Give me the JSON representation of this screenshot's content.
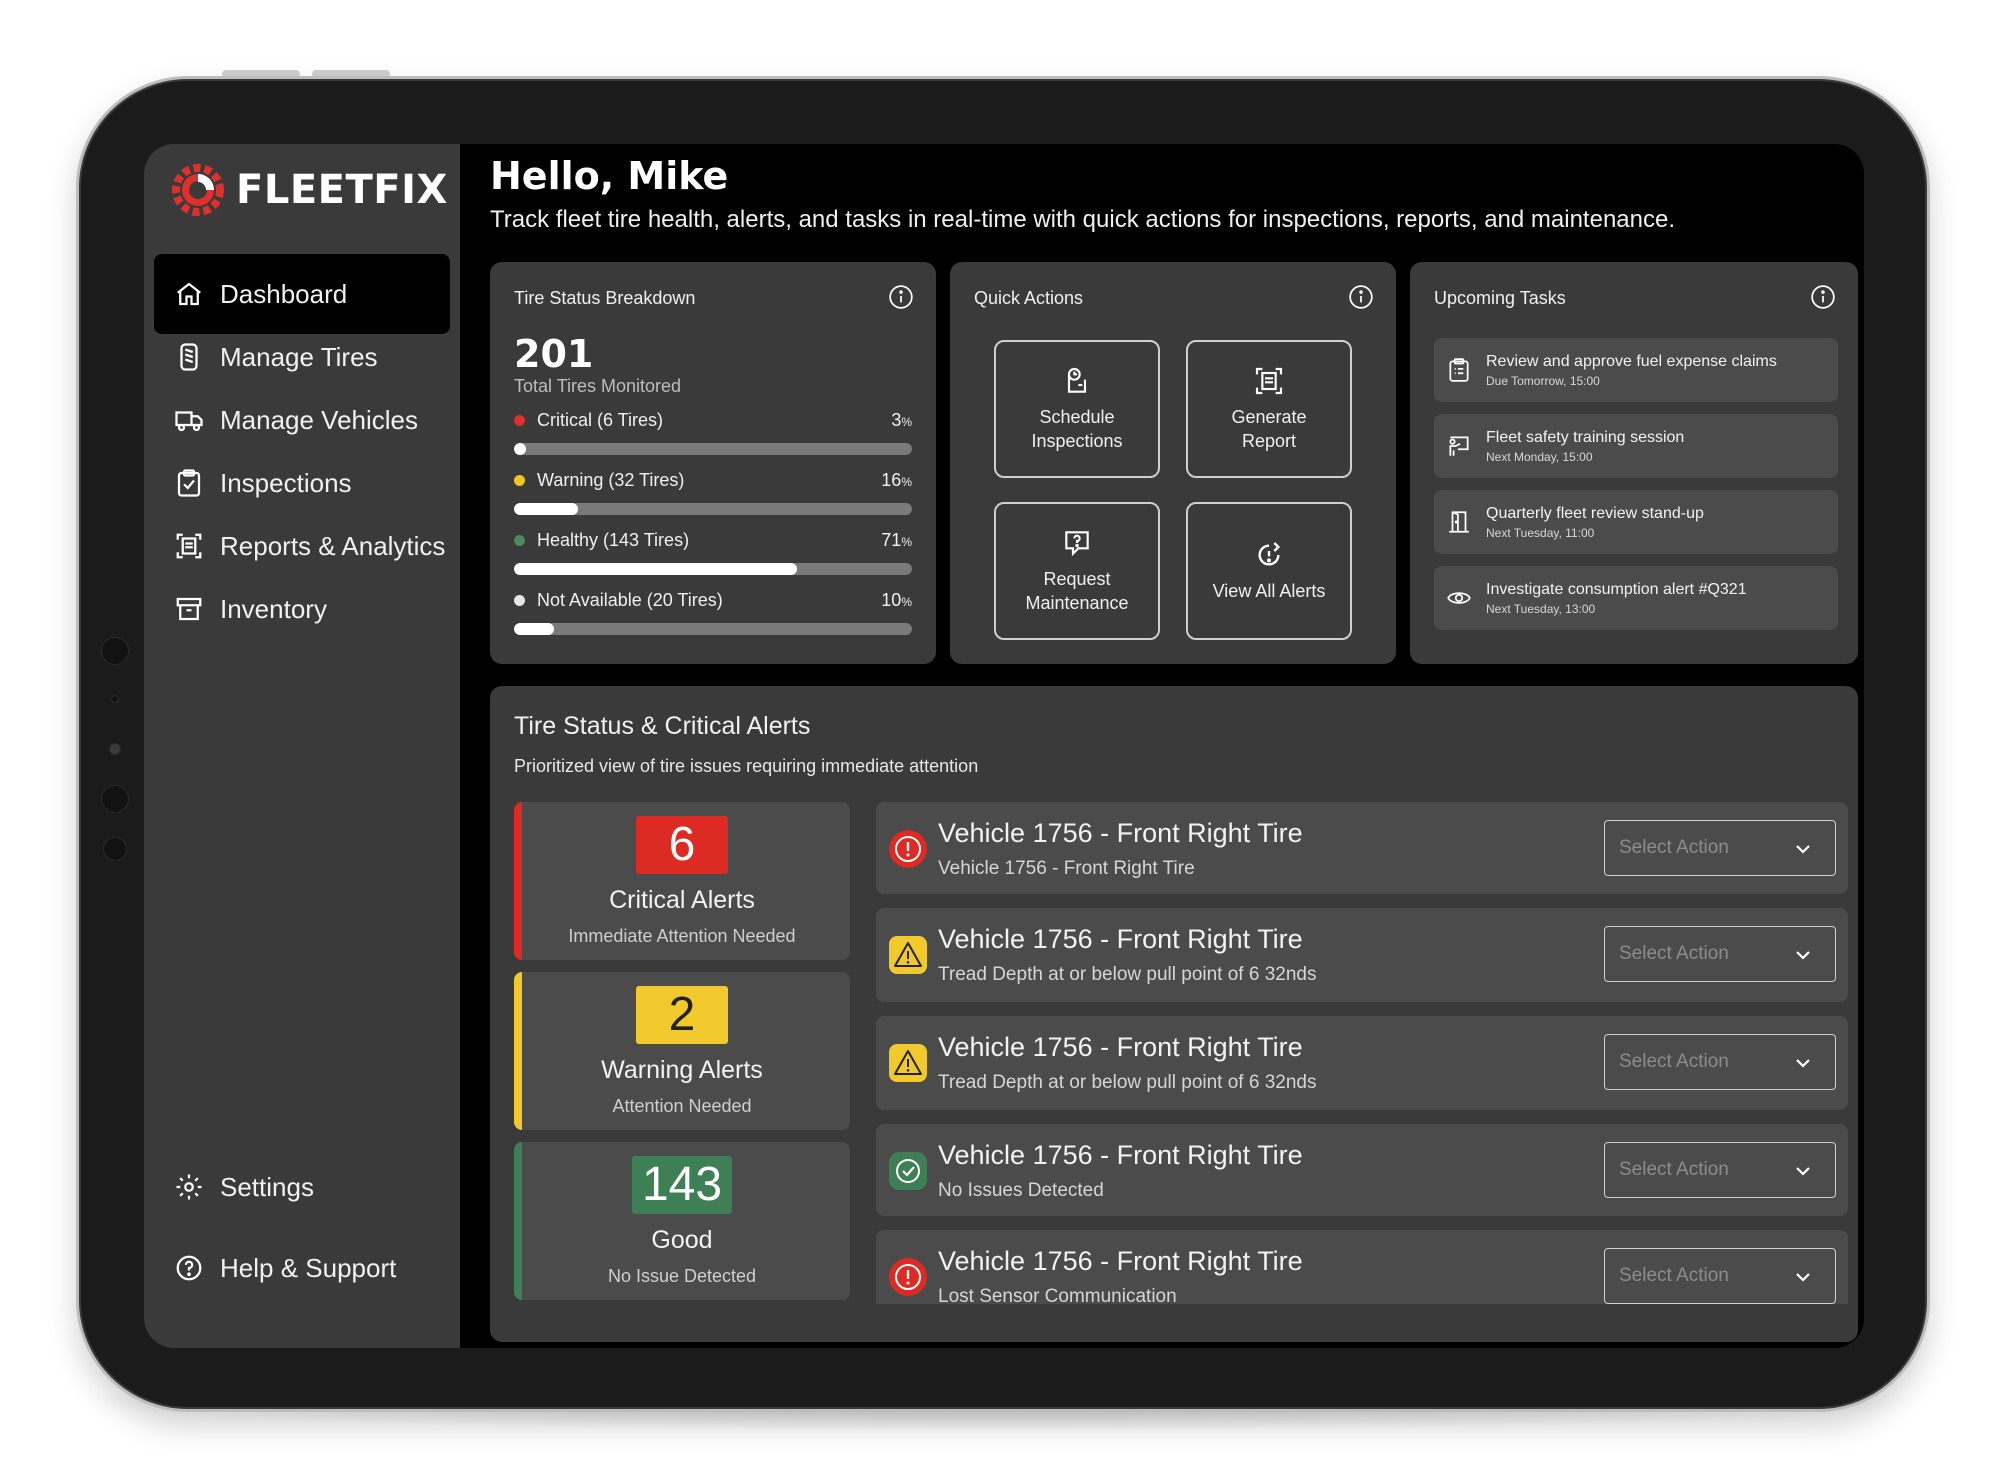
{
  "brand": {
    "name": "FLEETFIX"
  },
  "sidebar": {
    "items": [
      {
        "label": "Dashboard",
        "icon": "home-icon",
        "active": true
      },
      {
        "label": "Manage Tires",
        "icon": "tire-icon",
        "active": false
      },
      {
        "label": "Manage Vehicles",
        "icon": "truck-icon",
        "active": false
      },
      {
        "label": "Inspections",
        "icon": "clipboard-check-icon",
        "active": false
      },
      {
        "label": "Reports & Analytics",
        "icon": "report-icon",
        "active": false
      },
      {
        "label": "Inventory",
        "icon": "archive-icon",
        "active": false
      }
    ],
    "footer": [
      {
        "label": "Settings",
        "icon": "gear-icon"
      },
      {
        "label": "Help & Support",
        "icon": "help-icon"
      }
    ]
  },
  "header": {
    "greeting": "Hello, Mike",
    "subtitle": "Track fleet tire health, alerts, and tasks in real-time with quick actions for inspections, reports, and maintenance."
  },
  "tire_status": {
    "title": "Tire Status Breakdown",
    "total": "201",
    "total_label": "Total Tires Monitored",
    "rows": [
      {
        "label": "Critical (6 Tires)",
        "pct": "3",
        "fill": 0.03,
        "color": "#e0302b"
      },
      {
        "label": "Warning (32 Tires)",
        "pct": "16",
        "fill": 0.16,
        "color": "#f2c523"
      },
      {
        "label": "Healthy (143 Tires)",
        "pct": "71",
        "fill": 0.71,
        "color": "#4a8a5c"
      },
      {
        "label": "Not Available (20 Tires)",
        "pct": "10",
        "fill": 0.1,
        "color": "#e6e6e6"
      }
    ],
    "pct_unit": "%"
  },
  "quick_actions": {
    "title": "Quick Actions",
    "buttons": [
      {
        "label": "Schedule Inspections",
        "icon": "schedule-icon"
      },
      {
        "label": "Generate Report",
        "icon": "report-scan-icon"
      },
      {
        "label": "Request Maintenance",
        "icon": "message-question-icon"
      },
      {
        "label": "View All Alerts",
        "icon": "alert-refresh-icon"
      }
    ]
  },
  "tasks": {
    "title": "Upcoming Tasks",
    "items": [
      {
        "title": "Review and approve fuel expense claims",
        "due": "Due Tomorrow, 15:00",
        "icon": "checklist-icon"
      },
      {
        "title": "Fleet safety training session",
        "due": "Next Monday, 15:00",
        "icon": "presentation-icon"
      },
      {
        "title": "Quarterly fleet review stand-up",
        "due": "Next Tuesday, 11:00",
        "icon": "door-icon"
      },
      {
        "title": "Investigate consumption alert #Q321",
        "due": "Next Tuesday, 13:00",
        "icon": "eye-icon"
      }
    ]
  },
  "alerts_panel": {
    "title": "Tire Status & Critical Alerts",
    "subtitle": "Prioritized view of tire issues requiring immediate attention",
    "summary": [
      {
        "count": "6",
        "label": "Critical Alerts",
        "sub": "Immediate Attention Needed",
        "color": "#dd2a22"
      },
      {
        "count": "2",
        "label": "Warning Alerts",
        "sub": "Attention Needed",
        "color": "#f2c92c"
      },
      {
        "count": "143",
        "label": "Good",
        "sub": "No Issue Detected",
        "color": "#3f7f55"
      }
    ],
    "alerts": [
      {
        "title": "Vehicle 1756 - Front Right Tire",
        "sub": "Vehicle 1756 - Front Right Tire",
        "severity": "critical",
        "icon": "critical-alert-icon"
      },
      {
        "title": "Vehicle 1756 - Front Right Tire",
        "sub": "Tread Depth at or below pull point of 6 32nds",
        "severity": "warning",
        "icon": "warning-triangle-icon"
      },
      {
        "title": "Vehicle 1756 - Front Right Tire",
        "sub": "Tread Depth at or below pull point of 6 32nds",
        "severity": "warning",
        "icon": "warning-triangle-icon"
      },
      {
        "title": "Vehicle 1756 - Front Right Tire",
        "sub": "No Issues Detected",
        "severity": "good",
        "icon": "check-circle-icon"
      },
      {
        "title": "Vehicle 1756 - Front Right Tire",
        "sub": "Lost Sensor Communication",
        "severity": "critical",
        "icon": "critical-alert-icon"
      }
    ],
    "select_placeholder": "Select Action"
  }
}
